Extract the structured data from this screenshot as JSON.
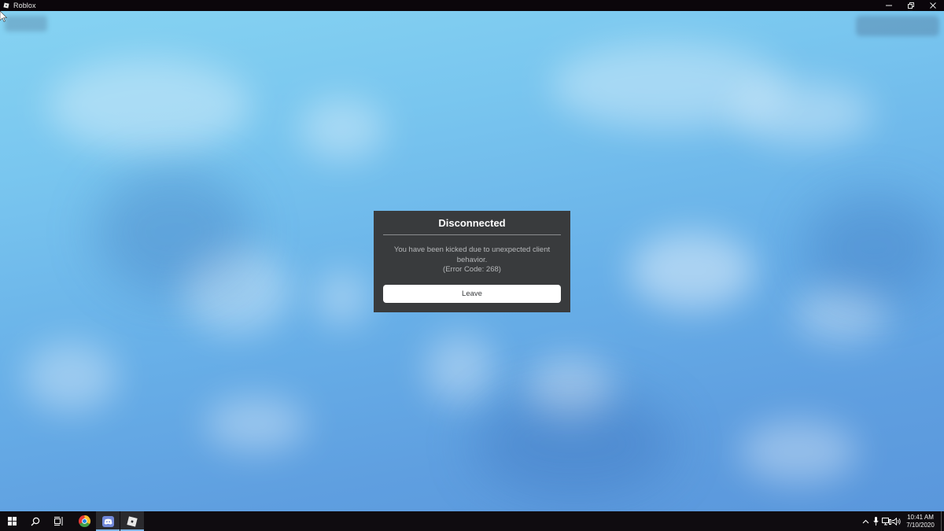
{
  "window": {
    "title": "Roblox"
  },
  "dialog": {
    "title": "Disconnected",
    "message_line1": "You have been kicked due to unexpected client",
    "message_line2": "behavior.",
    "message_line3": "(Error Code: 268)",
    "leave_label": "Leave"
  },
  "taskbar": {
    "items": [
      {
        "icon": "windows-start-icon"
      },
      {
        "icon": "search-icon"
      },
      {
        "icon": "task-view-icon"
      },
      {
        "icon": "chrome-icon"
      },
      {
        "icon": "discord-icon"
      },
      {
        "icon": "roblox-icon"
      }
    ],
    "clock_time": "10:41 AM",
    "clock_date": "7/10/2020"
  },
  "colors": {
    "dialog_bg": "#393b3d",
    "button_bg": "#ffffff",
    "taskbar_bg": "#0f0c10",
    "titlebar_bg": "#0b060b"
  }
}
